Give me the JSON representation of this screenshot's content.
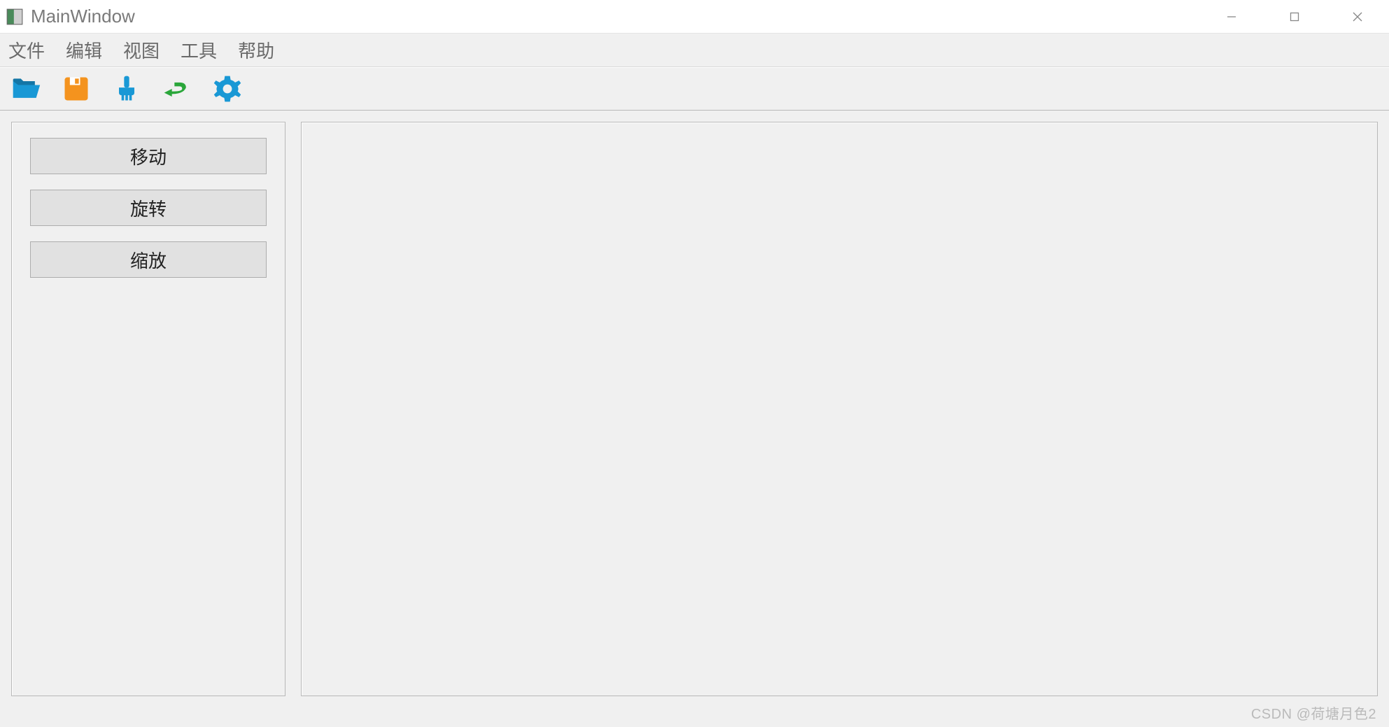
{
  "window": {
    "title": "MainWindow"
  },
  "menubar": {
    "items": [
      "文件",
      "编辑",
      "视图",
      "工具",
      "帮助"
    ]
  },
  "toolbar": {
    "icons": [
      {
        "name": "folder-open-icon",
        "color": "#1998d5"
      },
      {
        "name": "save-icon",
        "color": "#f4931e"
      },
      {
        "name": "brush-icon",
        "color": "#1998d5"
      },
      {
        "name": "undo-icon",
        "color": "#2aa63a"
      },
      {
        "name": "settings-icon",
        "color": "#1998d5"
      }
    ]
  },
  "sidepanel": {
    "buttons": [
      "移动",
      "旋转",
      "缩放"
    ]
  },
  "watermark": "CSDN @荷塘月色2"
}
